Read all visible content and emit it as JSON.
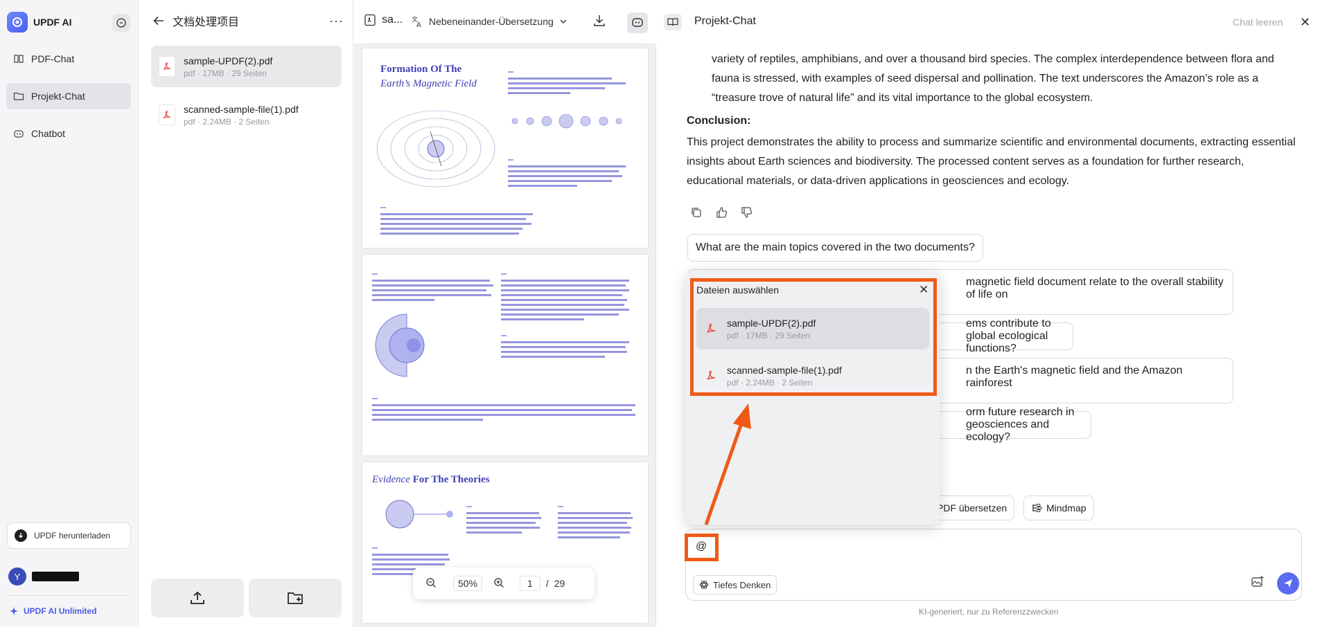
{
  "sidebar": {
    "brand": "UPDF AI",
    "items": [
      {
        "label": "PDF-Chat"
      },
      {
        "label": "Projekt-Chat"
      },
      {
        "label": "Chatbot"
      }
    ],
    "download_label": "UPDF herunterladen",
    "avatar_letter": "Y",
    "unlimited_label": "UPDF AI Unlimited"
  },
  "project": {
    "title": "文档处理项目",
    "files": [
      {
        "name": "sample-UPDF(2).pdf",
        "meta": "pdf · 17MB · 29 Seiten"
      },
      {
        "name": "scanned-sample-file(1).pdf",
        "meta": "pdf · 2.24MB · 2 Seiten"
      }
    ]
  },
  "viewer": {
    "doc_short": "sa...",
    "mode": "Nebeneinander-Übersetzung",
    "page1_title_a": "Formation Of The",
    "page1_title_b": "Earth’s Magnetic Field",
    "page3_title_a": "Evidence",
    "page3_title_b": "For The Theories",
    "zoom": "50%",
    "page_current": "1",
    "page_sep": "/",
    "page_total": "29"
  },
  "chat": {
    "title": "Projekt-Chat",
    "clear_label": "Chat leeren",
    "msg_top": "variety of reptiles, amphibians, and over a thousand bird species. The complex interdependence between flora and fauna is stressed, with examples of seed dispersal and pollination. The text underscores the Amazon’s role as a “treasure trove of natural life” and its vital importance to the global ecosystem.",
    "conclusion_head": "Conclusion:",
    "conclusion_body": "This project demonstrates the ability to process and summarize scientific and environmental documents, extracting essential insights about Earth sciences and biodiversity. The processed content serves as a foundation for further research, educational materials, or data-driven applications in geosciences and ecology.",
    "suggestions": [
      "What are the main topics covered in the two documents?",
      "magnetic field document relate to the overall stability of life on",
      "ems contribute to global ecological functions?",
      "n the Earth's magnetic field and the Amazon rainforest",
      "orm future research in geosciences and ecology?"
    ],
    "tools": [
      "PDF übersetzen",
      "Mindmap"
    ],
    "input_value": "@",
    "think_label": "Tiefes Denken",
    "disclaimer": "KI-generiert, nur zu Referenzzwecken"
  },
  "picker": {
    "title": "Dateien auswählen",
    "files": [
      {
        "name": "sample-UPDF(2).pdf",
        "meta": "pdf · 17MB · 29 Seiten"
      },
      {
        "name": "scanned-sample-file(1).pdf",
        "meta": "pdf · 2.24MB · 2 Seiten"
      }
    ]
  },
  "colors": {
    "accent": "#5b6cf0",
    "annotation": "#f05a16",
    "pdf_red": "#e4473c"
  }
}
